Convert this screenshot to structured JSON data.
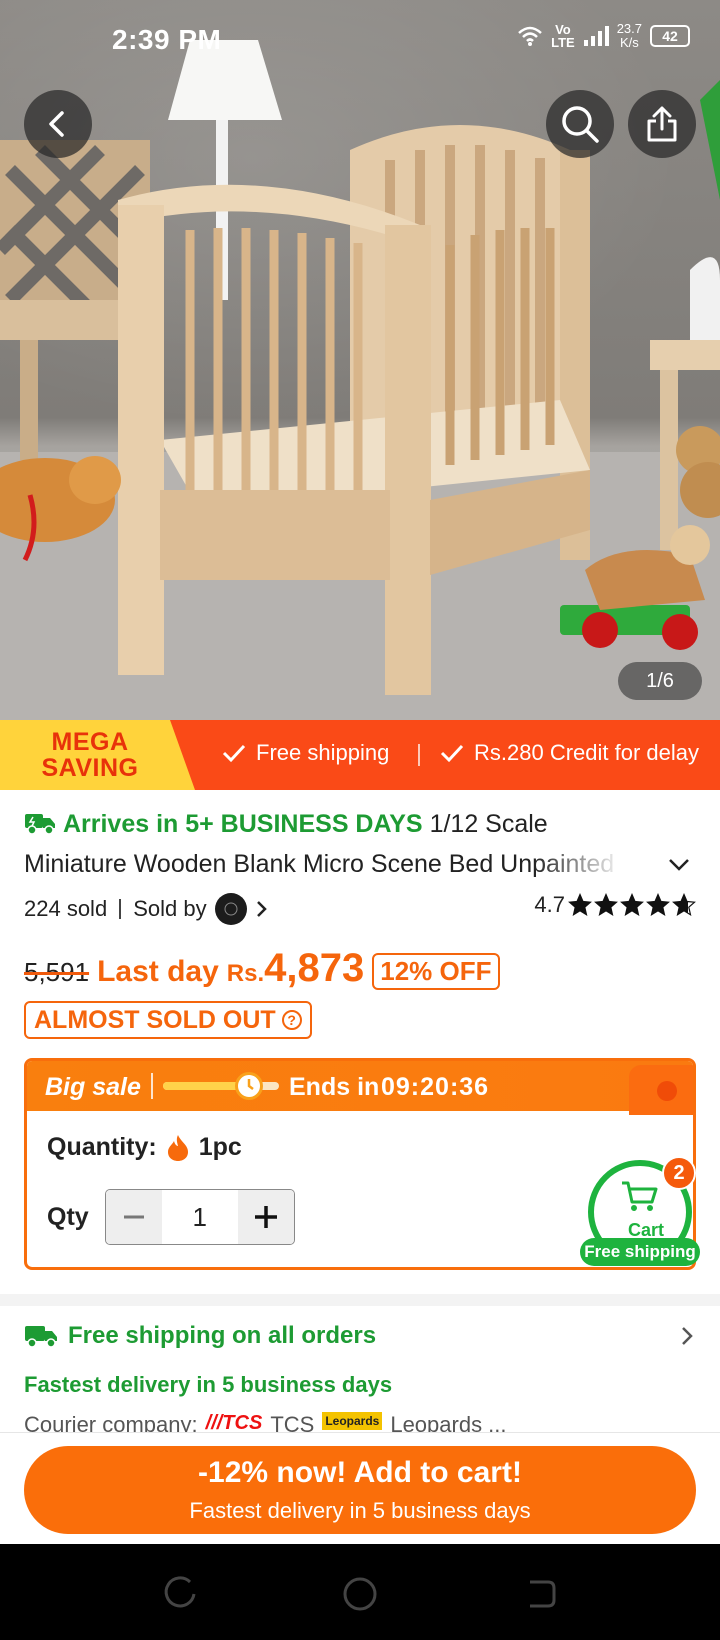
{
  "status_bar": {
    "time": "2:39 PM",
    "network_top": "Vo",
    "network_bottom": "LTE",
    "speed_value": "23.7",
    "speed_unit": "K/s",
    "battery": "42"
  },
  "gallery": {
    "counter": "1/6"
  },
  "promo": {
    "badge_line1": "MEGA",
    "badge_line2": "SAVING",
    "free_shipping": "Free shipping",
    "credit": "Rs.280 Credit for delay"
  },
  "product": {
    "arrives": "Arrives in 5+ BUSINESS DAYS",
    "title_part1": "1/12 Scale",
    "title_part2": "Miniature Wooden Blank Micro Scene Bed Unpainted",
    "sold": "224 sold",
    "sold_by": "Sold by",
    "rating": "4.7",
    "rating_stars": 4.7
  },
  "price": {
    "old": "5,591",
    "last_day": "Last day",
    "currency": "Rs.",
    "current": "4,873",
    "discount": "12% OFF",
    "stock_status": "ALMOST SOLD OUT"
  },
  "sale": {
    "label": "Big sale",
    "progress": 0.7,
    "ends_label": "Ends in",
    "timer": "09:20:36",
    "quantity_label": "Quantity:",
    "quantity_value": "1pc",
    "qty_label": "Qty",
    "qty_value": "1"
  },
  "cart": {
    "label": "Cart",
    "count": "2",
    "free_shipping": "Free shipping"
  },
  "shipping": {
    "free_all": "Free shipping on all orders",
    "fastest": "Fastest delivery in 5 business days",
    "courier_label": "Courier company:",
    "courier_1": "TCS",
    "courier_2": "Leopards ..."
  },
  "cta": {
    "main": "-12% now! Add to cart!",
    "sub": "Fastest delivery in 5 business days"
  },
  "colors": {
    "brand_orange": "#fa6e0a",
    "green": "#1d9b33",
    "promo_red": "#fa4a17",
    "mega_yellow": "#ffd33b"
  },
  "icons": [
    "back-icon",
    "search-icon",
    "share-icon",
    "check-icon",
    "truck-icon",
    "chevron-down-icon",
    "chevron-right-icon",
    "star-icon",
    "flame-icon",
    "minus-icon",
    "plus-icon",
    "cart-icon",
    "wifi-icon",
    "signal-icon"
  ]
}
